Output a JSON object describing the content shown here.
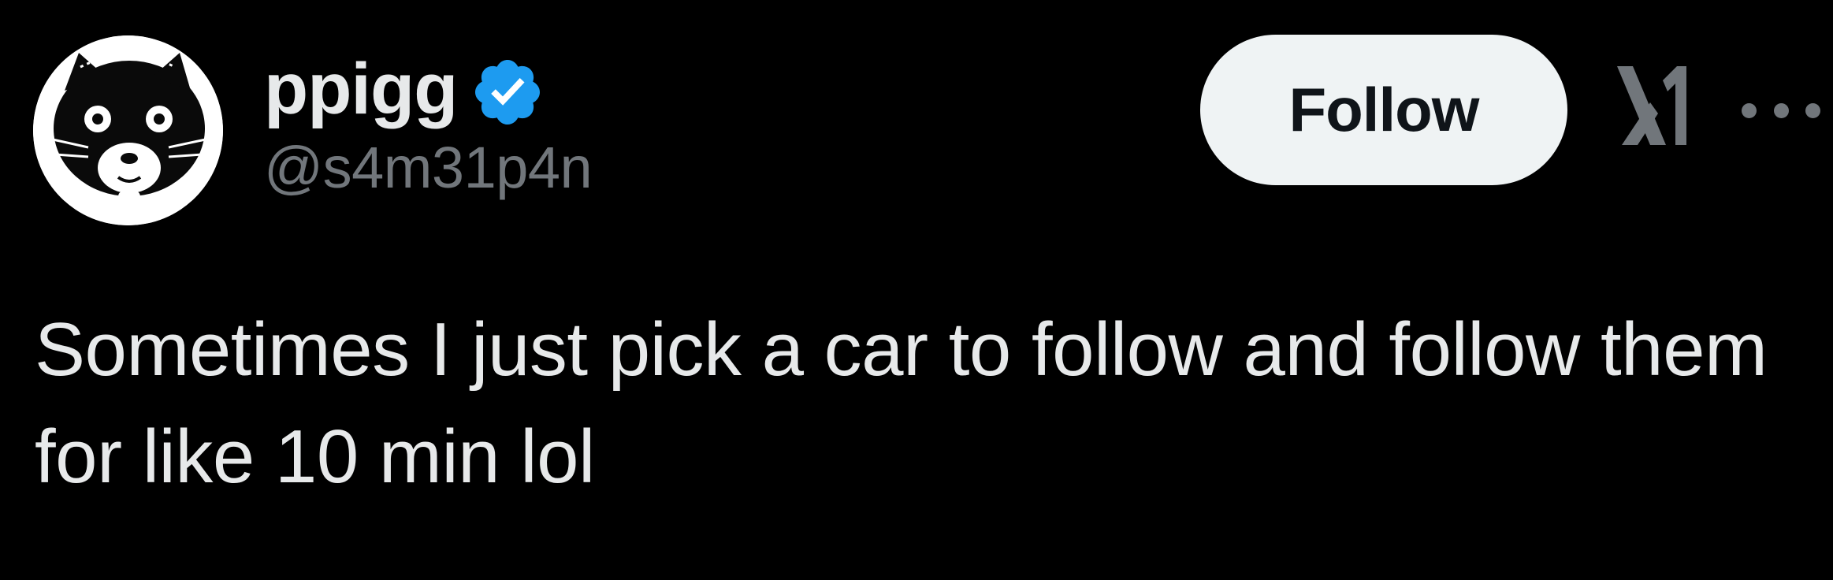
{
  "author": {
    "display_name": "ppigg",
    "handle": "@s4m31p4n",
    "verified": true,
    "verified_badge_icon": "verified-badge-icon",
    "avatar_icon": "cat-avatar-image"
  },
  "actions": {
    "follow_label": "Follow",
    "logo_icon": "x-logo-icon",
    "more_icon": "more-options-icon"
  },
  "tweet": {
    "text": "Sometimes I just pick a car to follow and follow them for like 10 min lol"
  },
  "colors": {
    "background": "#000000",
    "primary_text": "#e7e9ea",
    "secondary_text": "#71767b",
    "verified_blue": "#1d9bf0",
    "follow_button_bg": "#eff3f4",
    "follow_button_text": "#0f1419"
  }
}
